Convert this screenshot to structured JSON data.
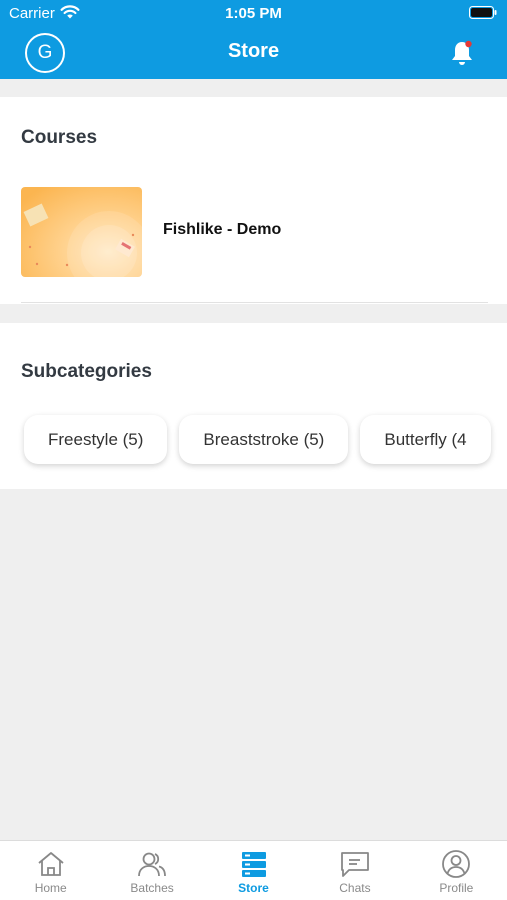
{
  "status_bar": {
    "carrier": "Carrier",
    "time": "1:05 PM"
  },
  "header": {
    "avatar_letter": "G",
    "title": "Store"
  },
  "courses": {
    "title": "Courses",
    "items": [
      {
        "name": "Fishlike - Demo"
      }
    ]
  },
  "subcategories": {
    "title": "Subcategories",
    "chips": [
      "Freestyle (5)",
      "Breaststroke (5)",
      "Butterfly (4"
    ]
  },
  "tabbar": {
    "active": "Store",
    "tabs": [
      {
        "label": "Home",
        "icon": "home-icon"
      },
      {
        "label": "Batches",
        "icon": "batches-icon"
      },
      {
        "label": "Store",
        "icon": "store-icon"
      },
      {
        "label": "Chats",
        "icon": "chats-icon"
      },
      {
        "label": "Profile",
        "icon": "profile-icon"
      }
    ]
  },
  "colors": {
    "accent": "#0e9be1",
    "notification_dot": "#e53935"
  }
}
